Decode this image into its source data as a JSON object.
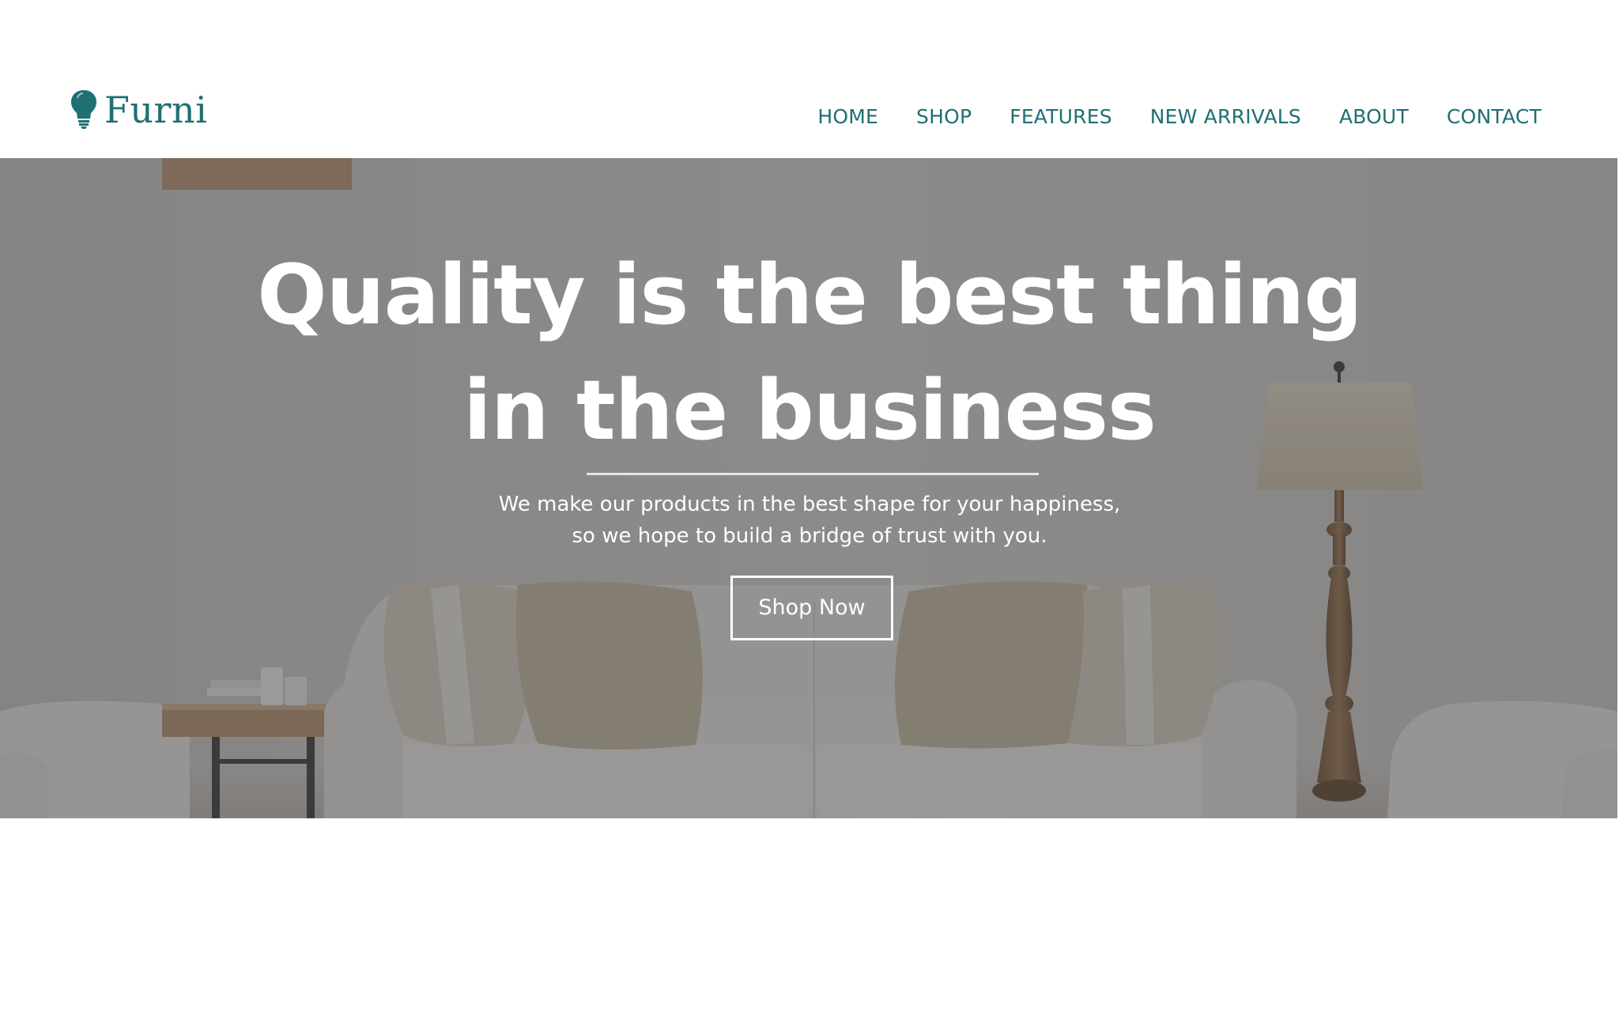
{
  "brand": {
    "name": "Furni",
    "logo_icon": "lightbulb-icon",
    "color": "#1f6f73"
  },
  "nav": {
    "items": [
      {
        "label": "HOME"
      },
      {
        "label": "SHOP"
      },
      {
        "label": "FEATURES"
      },
      {
        "label": "NEW ARRIVALS"
      },
      {
        "label": "ABOUT"
      },
      {
        "label": "CONTACT"
      }
    ]
  },
  "hero": {
    "title_line1": "Quality is the best thing",
    "title_line2": "in the business",
    "subtitle_line1": "We make our products in the best shape for your happiness,",
    "subtitle_line2": "so we hope to build a bridge of trust with you.",
    "button_label": "Shop Now",
    "background_image": "living-room-sofa-photo",
    "overlay_color": "#464646"
  }
}
